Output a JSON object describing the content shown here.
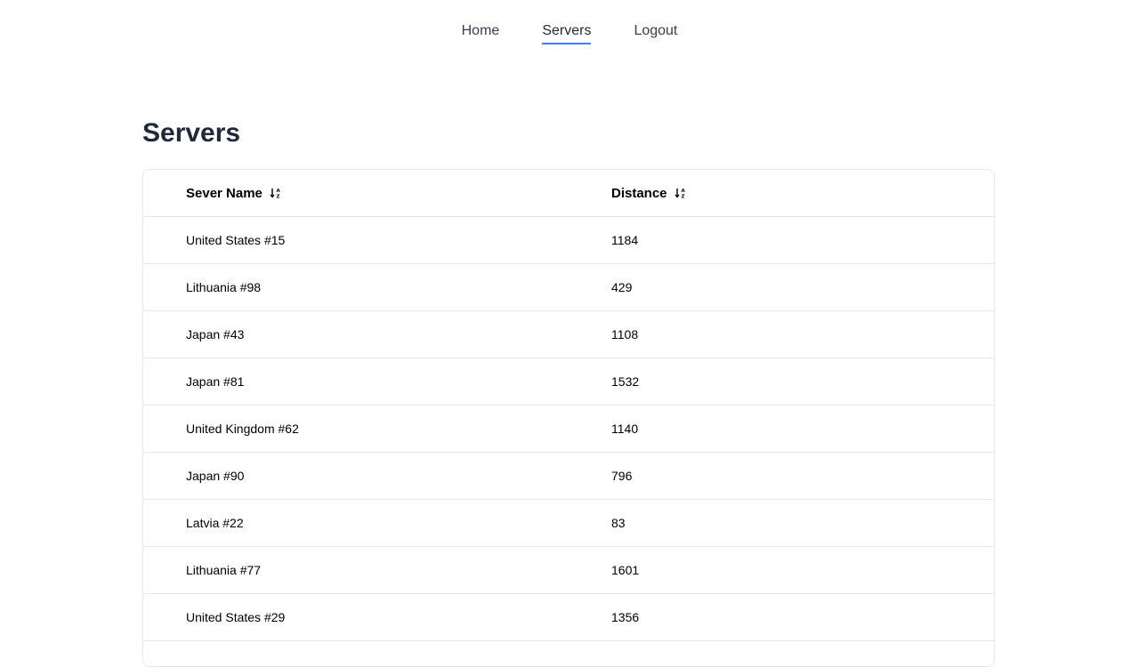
{
  "nav": {
    "links": [
      {
        "label": "Home",
        "active": false
      },
      {
        "label": "Servers",
        "active": true
      },
      {
        "label": "Logout",
        "active": false
      }
    ]
  },
  "page": {
    "title": "Servers"
  },
  "table": {
    "headers": {
      "name": "Sever Name",
      "distance": "Distance"
    },
    "sort_icon": "sort-ascending-icon",
    "rows": [
      {
        "name": "United States #15",
        "distance": "1184"
      },
      {
        "name": "Lithuania #98",
        "distance": "429"
      },
      {
        "name": "Japan #43",
        "distance": "1108"
      },
      {
        "name": "Japan #81",
        "distance": "1532"
      },
      {
        "name": "United Kingdom #62",
        "distance": "1140"
      },
      {
        "name": "Japan #90",
        "distance": "796"
      },
      {
        "name": "Latvia #22",
        "distance": "83"
      },
      {
        "name": "Lithuania #77",
        "distance": "1601"
      },
      {
        "name": "United States #29",
        "distance": "1356"
      }
    ]
  },
  "colors": {
    "accent": "#3b82f6",
    "border": "#e5e7eb",
    "title": "#1f2937"
  }
}
